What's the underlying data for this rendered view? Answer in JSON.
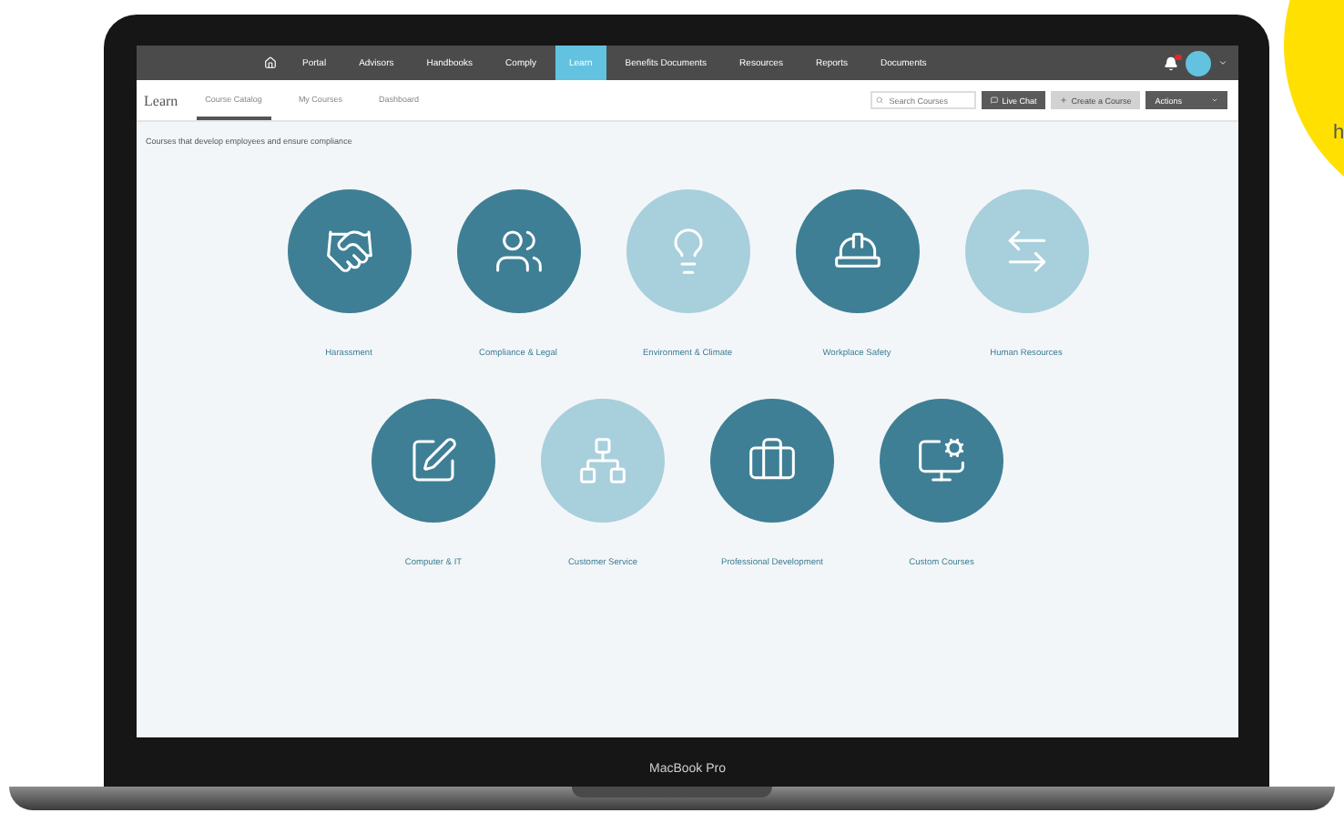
{
  "nav": {
    "items": [
      {
        "label": "Portal",
        "selected": false
      },
      {
        "label": "Advisors",
        "selected": false
      },
      {
        "label": "Handbooks",
        "selected": false
      },
      {
        "label": "Comply",
        "selected": false
      },
      {
        "label": "Learn",
        "selected": true
      },
      {
        "label": "Benefits Documents",
        "selected": false
      },
      {
        "label": "Resources",
        "selected": false
      },
      {
        "label": "Reports",
        "selected": false
      },
      {
        "label": "Documents",
        "selected": false
      }
    ]
  },
  "header": {
    "title": "Learn",
    "tabs": [
      {
        "label": "Course Catalog",
        "selected": true
      },
      {
        "label": "My Courses",
        "selected": false
      },
      {
        "label": "Dashboard",
        "selected": false
      }
    ],
    "search": {
      "placeholder": "Search Courses"
    },
    "buttons": [
      {
        "label": "Live Chat",
        "disabled": false
      },
      {
        "label": "Create a Course",
        "disabled": true
      },
      {
        "label": "Actions",
        "disabled": false
      }
    ]
  },
  "subtitle": "Courses that develop employees and ensure compliance",
  "categories": [
    [
      {
        "label": "Harassment",
        "color": "#3e7f95"
      },
      {
        "label": "Compliance & Legal",
        "color": "#3e7f95"
      },
      {
        "label": "Environment & Climate",
        "color": "#a8cfdc"
      },
      {
        "label": "Workplace Safety",
        "color": "#3e7f95"
      },
      {
        "label": "Human Resources",
        "color": "#a8cfdc"
      }
    ],
    [
      {
        "label": "Computer & IT",
        "color": "#3e7f95"
      },
      {
        "label": "Customer Service",
        "color": "#a8cfdc"
      },
      {
        "label": "Professional Development",
        "color": "#3e7f95"
      },
      {
        "label": "Custom Courses",
        "color": "#3e7f95"
      }
    ]
  ],
  "laptop": {
    "model": "MacBook Pro"
  },
  "corner": {
    "text": "h"
  }
}
